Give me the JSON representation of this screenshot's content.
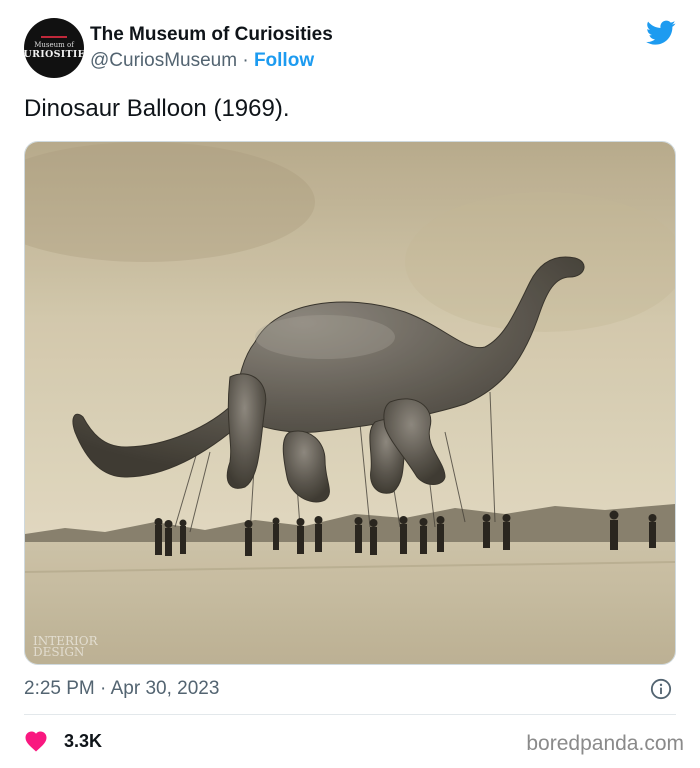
{
  "author": {
    "name": "The Museum of Curiosities",
    "handle": "@CuriosMuseum",
    "separator": "·",
    "follow_label": "Follow",
    "avatar": {
      "top_text": "Museum of",
      "main_text": "CURIOSITIES"
    }
  },
  "tweet": {
    "text": "Dinosaur Balloon (1969).",
    "time": "2:25 PM",
    "date": "Apr 30, 2023",
    "time_date": "2:25 PM · Apr 30, 2023",
    "likes": "3.3K"
  },
  "photo": {
    "watermark_line1": "INTERIOR",
    "watermark_line2": "DESIGN"
  },
  "icons": {
    "brand": "twitter-bird-icon",
    "info": "info-icon",
    "like": "heart-icon"
  },
  "colors": {
    "accent": "#1d9bf0",
    "like": "#f91880",
    "secondary_text": "#536471"
  },
  "site_watermark": "boredpanda.com"
}
